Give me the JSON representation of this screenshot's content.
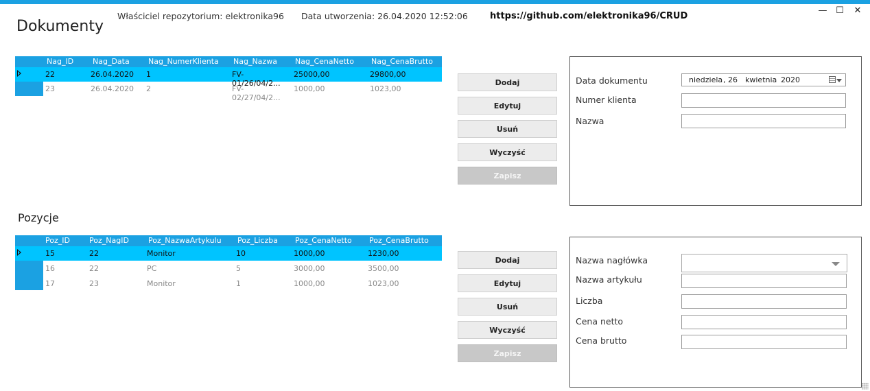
{
  "header": {
    "owner": "Właściciel repozytorium: elektronika96",
    "created": "Data utworzenia: 26.04.2020 12:52:06",
    "url": "https://github.com/elektronika96/CRUD",
    "minimize_glyph": "—",
    "maximize_glyph": "☐",
    "close_glyph": "✕"
  },
  "documents": {
    "title": "Dokumenty",
    "columns": [
      "Nag_ID",
      "Nag_Data",
      "Nag_NumerKlienta",
      "Nag_Nazwa",
      "Nag_CenaNetto",
      "Nag_CenaBrutto"
    ],
    "rows": [
      {
        "id": "22",
        "date": "26.04.2020",
        "client": "1",
        "name": "FV-01/26/04/2...",
        "net": "25000,00",
        "gross": "29800,00"
      },
      {
        "id": "23",
        "date": "26.04.2020",
        "client": "2",
        "name": "FV-02/27/04/2...",
        "net": "1000,00",
        "gross": "1023,00"
      }
    ],
    "buttons": {
      "add": "Dodaj",
      "edit": "Edytuj",
      "delete": "Usuń",
      "clear": "Wyczyść",
      "save": "Zapisz"
    },
    "form": {
      "date_label": "Data dokumentu",
      "date_weekday": "niedziela",
      "date_day": ", 26",
      "date_month": "kwietnia",
      "date_year": "2020",
      "client_label": "Numer klienta",
      "client_value": "",
      "name_label": "Nazwa",
      "name_value": ""
    }
  },
  "positions": {
    "title": "Pozycje",
    "columns": [
      "Poz_ID",
      "Poz_NagID",
      "Poz_NazwaArtykulu",
      "Poz_Liczba",
      "Poz_CenaNetto",
      "Poz_CenaBrutto"
    ],
    "rows": [
      {
        "id": "15",
        "header_id": "22",
        "article": "Monitor",
        "qty": "10",
        "net": "1000,00",
        "gross": "1230,00"
      },
      {
        "id": "16",
        "header_id": "22",
        "article": "PC",
        "qty": "5",
        "net": "3000,00",
        "gross": "3500,00"
      },
      {
        "id": "17",
        "header_id": "23",
        "article": "Monitor",
        "qty": "1",
        "net": "1000,00",
        "gross": "1023,00"
      }
    ],
    "buttons": {
      "add": "Dodaj",
      "edit": "Edytuj",
      "delete": "Usuń",
      "clear": "Wyczyść",
      "save": "Zapisz"
    },
    "form": {
      "header_label": "Nazwa nagłówka",
      "header_value": "",
      "article_label": "Nazwa artykułu",
      "qty_label": "Liczba",
      "net_label": "Cena netto",
      "gross_label": "Cena brutto"
    }
  },
  "colors": {
    "accent": "#1ba1e2",
    "selected_row": "#00c4ff",
    "button": "#ececec",
    "button_disabled": "#c8c8c8"
  }
}
